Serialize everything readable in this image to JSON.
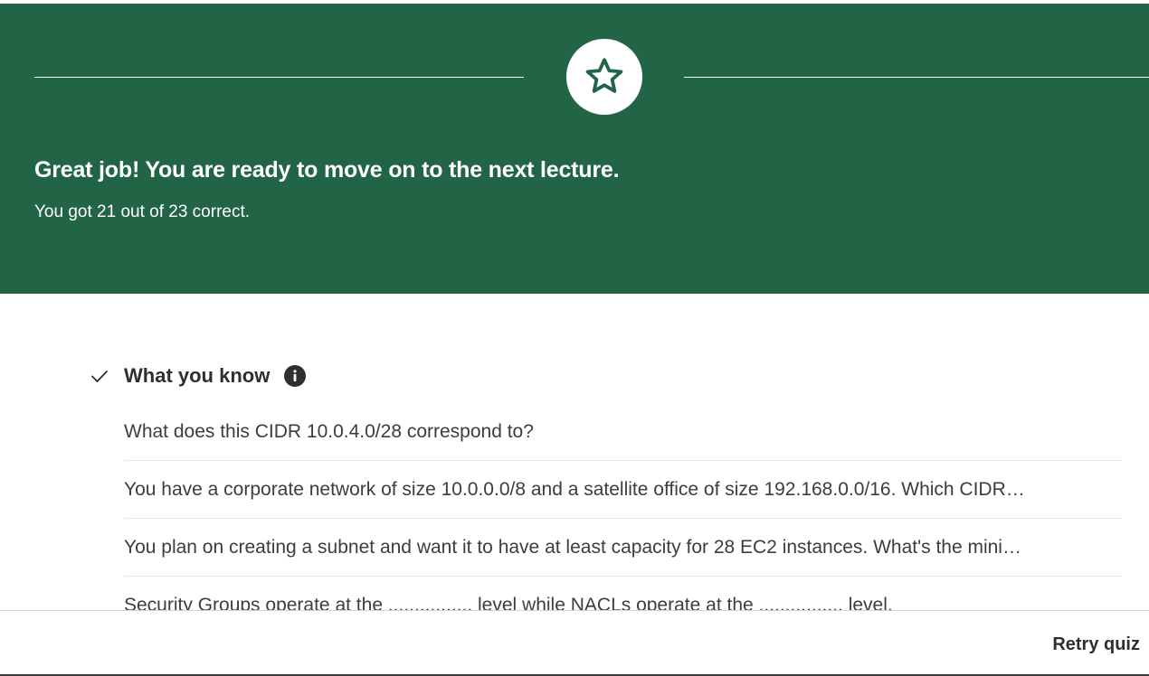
{
  "banner": {
    "headline": "Great job! You are ready to move on to the next lecture.",
    "score_text": "You got 21 out of 23 correct.",
    "badge_icon": "star-icon",
    "background_color": "#226446"
  },
  "section": {
    "title": "What you know",
    "status_icon": "check-icon",
    "info_icon": "info-icon"
  },
  "questions": [
    "What does this CIDR 10.0.4.0/28 correspond to?",
    "You have a corporate network of size 10.0.0.0/8 and a satellite office of size 192.168.0.0/16. Which CIDR…",
    "You plan on creating a subnet and want it to have at least capacity for 28 EC2 instances. What's the mini…",
    "Security Groups operate at the ................ level while NACLs operate at the ................ level."
  ],
  "footer": {
    "retry_label": "Retry quiz"
  }
}
